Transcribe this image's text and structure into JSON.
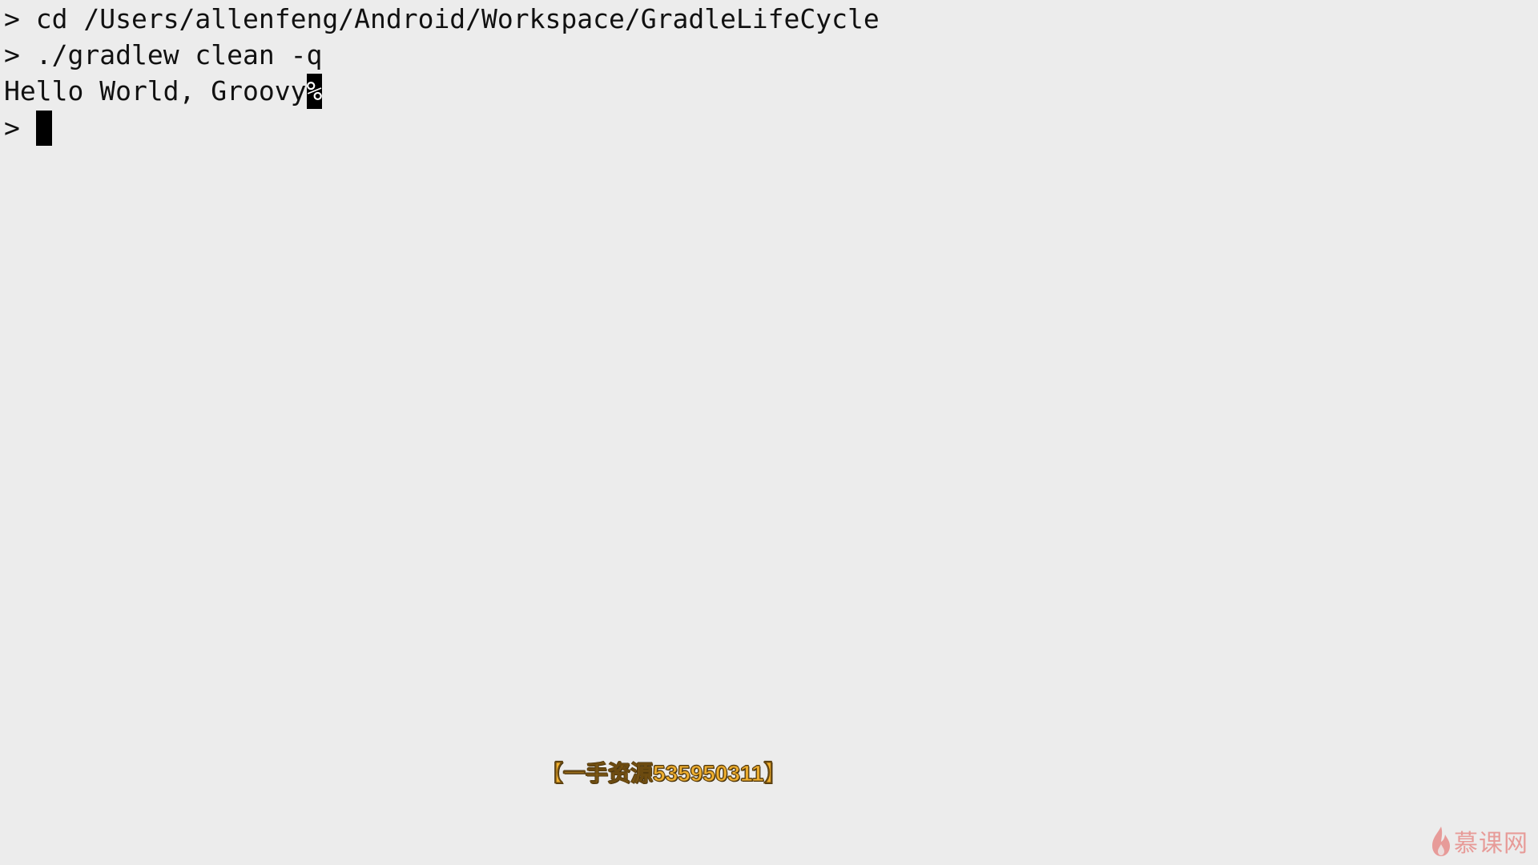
{
  "terminal": {
    "lines": [
      {
        "prompt": ">",
        "text": "cd /Users/allenfeng/Android/Workspace/GradleLifeCycle"
      },
      {
        "prompt": ">",
        "text": "./gradlew clean -q"
      },
      {
        "output": "Hello World, Groovy",
        "end_mark": "%"
      },
      {
        "prompt": ">",
        "text": ""
      }
    ],
    "background_color": "#ececec",
    "text_color": "#111111",
    "cursor_color": "#000000"
  },
  "overlay": {
    "banner_text": "【一手资源535950311】",
    "banner_color": "#f0b030"
  },
  "logo": {
    "text": "慕课网",
    "icon": "flame-icon",
    "color": "#e35a55"
  }
}
